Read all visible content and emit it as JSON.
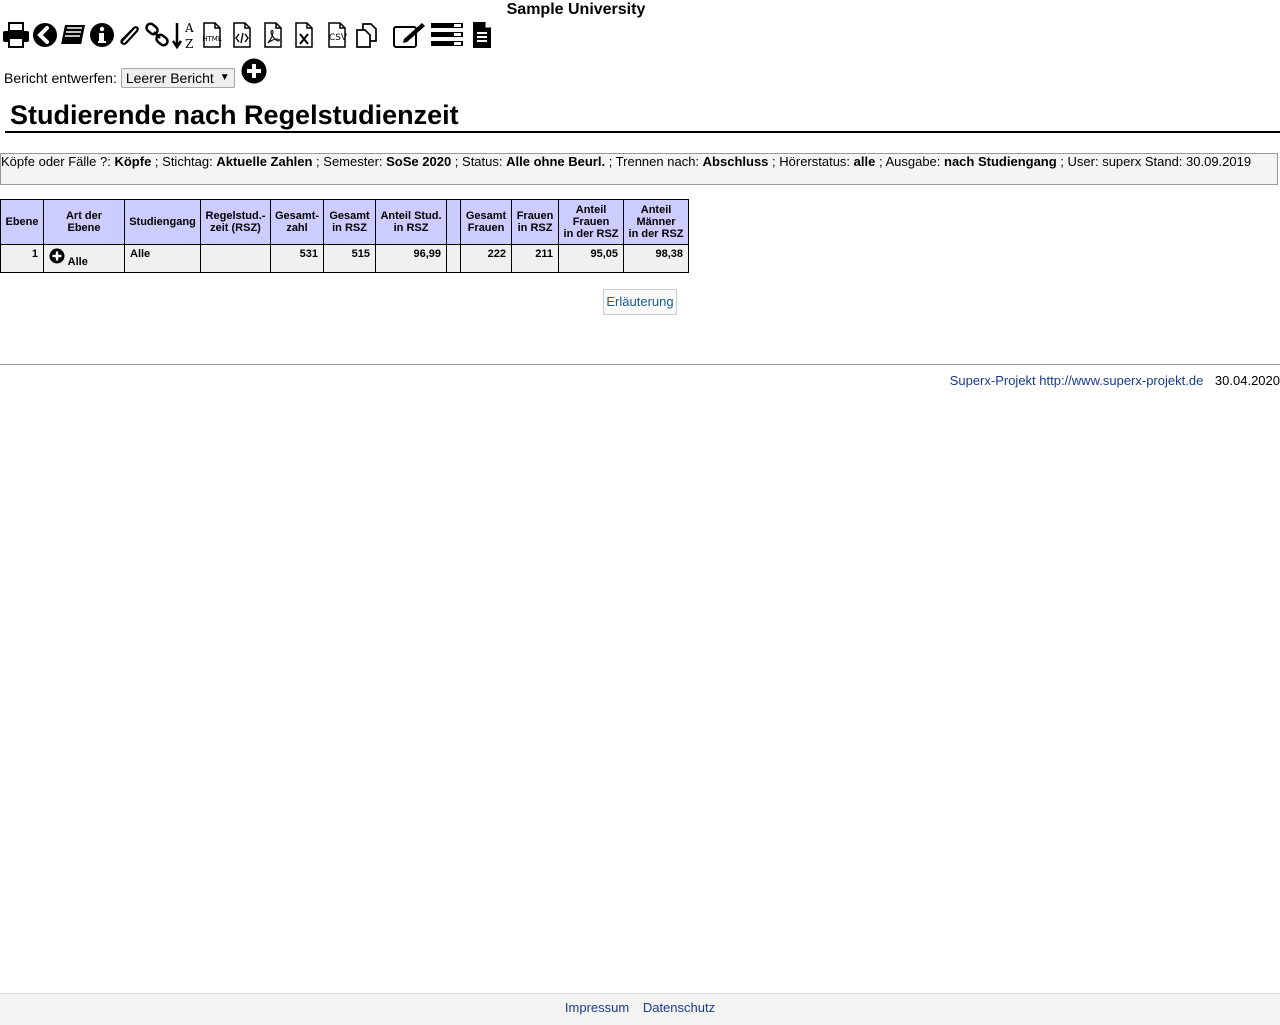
{
  "header": {
    "university": "Sample University"
  },
  "toolbar": {
    "items": [
      {
        "name": "print-icon"
      },
      {
        "name": "back-icon"
      },
      {
        "name": "books-icon"
      },
      {
        "name": "info-icon"
      },
      {
        "name": "paperclip-icon"
      },
      {
        "name": "link-icon"
      },
      {
        "name": "sort-alpha-icon",
        "top": "A",
        "bottom": "Z"
      },
      {
        "name": "html-export-icon",
        "label": "HTML"
      },
      {
        "name": "code-export-icon"
      },
      {
        "name": "pdf-export-icon"
      },
      {
        "name": "excel-export-icon"
      },
      {
        "name": "csv-export-icon",
        "label": "CSV"
      },
      {
        "name": "copy-icon"
      },
      {
        "name": "edit-icon"
      },
      {
        "name": "list-icon"
      },
      {
        "name": "document-icon"
      }
    ]
  },
  "design": {
    "label": "Bericht entwerfen:",
    "selected": "Leerer Bericht"
  },
  "page_title": "Studierende nach Regelstudienzeit",
  "filters": {
    "f1_label": "Köpfe oder Fälle ?: ",
    "f1_value": "Köpfe",
    "f2_label": " ; Stichtag: ",
    "f2_value": "Aktuelle Zahlen",
    "f3_label": " ; Semester: ",
    "f3_value": "SoSe 2020",
    "f4_label": " ; Status: ",
    "f4_value": "Alle ohne Beurl.",
    "f5_label": " ; Trennen nach: ",
    "f5_value": "Abschluss",
    "f6_label": " ; Hörerstatus: ",
    "f6_value": "alle",
    "f7_label": " ; Ausgabe: ",
    "f7_value": "nach Studiengang",
    "f8_text": " ; User: superx  Stand: 30.09.2019"
  },
  "table": {
    "headers": {
      "ebene": "Ebene",
      "art": "Art der Ebene",
      "studiengang": "Studiengang",
      "rsz_1": "Regelstud.-",
      "rsz_2": "zeit (RSZ)",
      "gesamt_1": "Gesamt-",
      "gesamt_2": "zahl",
      "gesamt_rsz_1": "Gesamt",
      "gesamt_rsz_2": "in RSZ",
      "anteil_1": "Anteil Stud.",
      "anteil_2": "in RSZ",
      "empty": "",
      "frauen_1": "Gesamt",
      "frauen_2": "Frauen",
      "frauen_rsz_1": "Frauen",
      "frauen_rsz_2": "in RSZ",
      "af_1": "Anteil",
      "af_2": "Frauen",
      "af_3": "in der RSZ",
      "am_1": "Anteil",
      "am_2": "Männer",
      "am_3": "in der RSZ"
    },
    "row": {
      "ebene": "1",
      "art": "Alle",
      "studiengang": "Alle",
      "rsz": "",
      "gesamt": "531",
      "gesamt_rsz": "515",
      "anteil": "96,99",
      "empty": "",
      "frauen": "222",
      "frauen_rsz": "211",
      "anteil_frauen": "95,05",
      "anteil_maenner": "98,38"
    }
  },
  "explain_button": "Erläuterung",
  "footer": {
    "project_text": "Superx-Projekt http://www.superx-projekt.de",
    "date": "30.04.2020"
  },
  "bottom_links": {
    "impressum": "Impressum",
    "datenschutz": "Datenschutz"
  }
}
